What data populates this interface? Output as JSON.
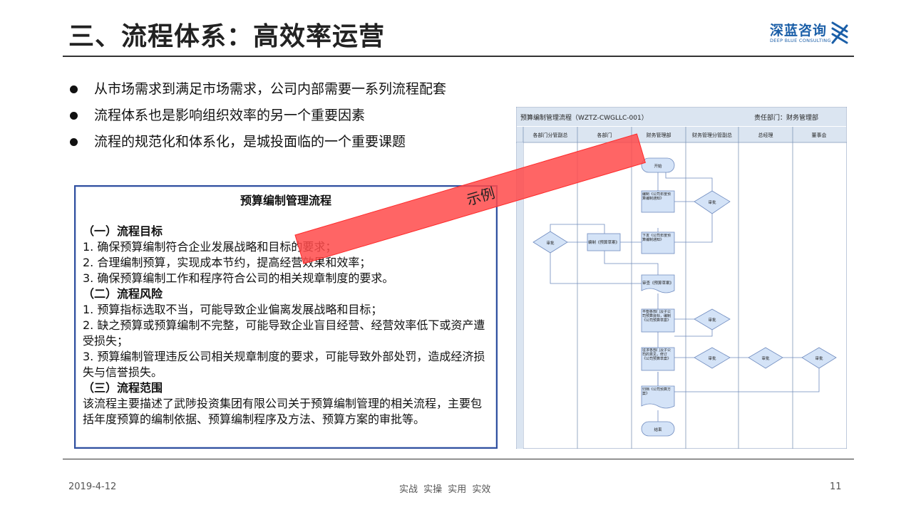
{
  "slide": {
    "title": "三、流程体系：高效率运营",
    "bullets": [
      "从市场需求到满足市场需求，公司内部需要一系列流程配套",
      "流程体系也是影响组织效率的另一个重要因素",
      "流程的规范化和体系化，是城投面临的一个重要课题"
    ]
  },
  "logo": {
    "cn": "深蓝咨询",
    "en": "DEEP BLUE CONSULTING"
  },
  "textbox": {
    "title": "预算编制管理流程",
    "sections": [
      {
        "heading": "（一）流程目标",
        "lines": [
          "1. 确保预算编制符合企业发展战略和目标的要求；",
          "2. 合理编制预算，实现成本节约，提高经营效果和效率；",
          "3. 确保预算编制工作和程序符合公司的相关规章制度的要求。"
        ]
      },
      {
        "heading": "（二）流程风险",
        "lines": [
          "1. 预算指标选取不当，可能导致企业偏离发展战略和目标；",
          "2. 缺之预算或预算编制不完整，可能导致企业盲目经营、经营效率低下或资产遭受损失；",
          "3. 预算编制管理违反公司相关规章制度的要求，可能导致外部处罚，造成经济损失与信誉损失。"
        ]
      },
      {
        "heading": "（三）流程范围",
        "lines": [
          "该流程主要描述了武陟投资集团有限公司关于预算编制管理的相关流程，主要包括年度预算的编制依据、预算编制程序及方法、预算方案的审批等。"
        ]
      }
    ]
  },
  "banner": {
    "text": "示例"
  },
  "flowchart": {
    "title": "预算编制管理流程（WZTZ-CWGLLC-001）",
    "dept": "责任部门：财务管理部",
    "lanes": [
      "各部门分管副总",
      "各部门",
      "财务管理部",
      "财务管理分管副总",
      "总经理",
      "董事会"
    ],
    "nodes": {
      "start": "开始",
      "issue": "编制《公司年度预算编制通知》",
      "review1": "审批",
      "dispatch": "下发《公司年度预算编制通知》",
      "compile": "编制《预算草案》",
      "review_dept": "审批",
      "summary": "审查《预算草案》",
      "balance": "平衡各部门及子公司预算目标，编制《公司预算草案》",
      "review2": "审批",
      "feedback": "征求各部门及子公司的意见，修订《公司预算草案》",
      "review3": "审批",
      "review4": "审批",
      "review5": "审批",
      "archive": "归档《公司预算方案》",
      "end": "结束"
    },
    "flags": {
      "no": "否",
      "yes": "是"
    }
  },
  "footer": {
    "date": "2019-4-12",
    "slogan": "实战  实操  实用  实效",
    "page": "11"
  },
  "colors": {
    "accent": "#1b5fa8",
    "banner": "#ff4a4a",
    "box_border": "#2f4f9f",
    "lane_bg": "#dbe5f1"
  }
}
